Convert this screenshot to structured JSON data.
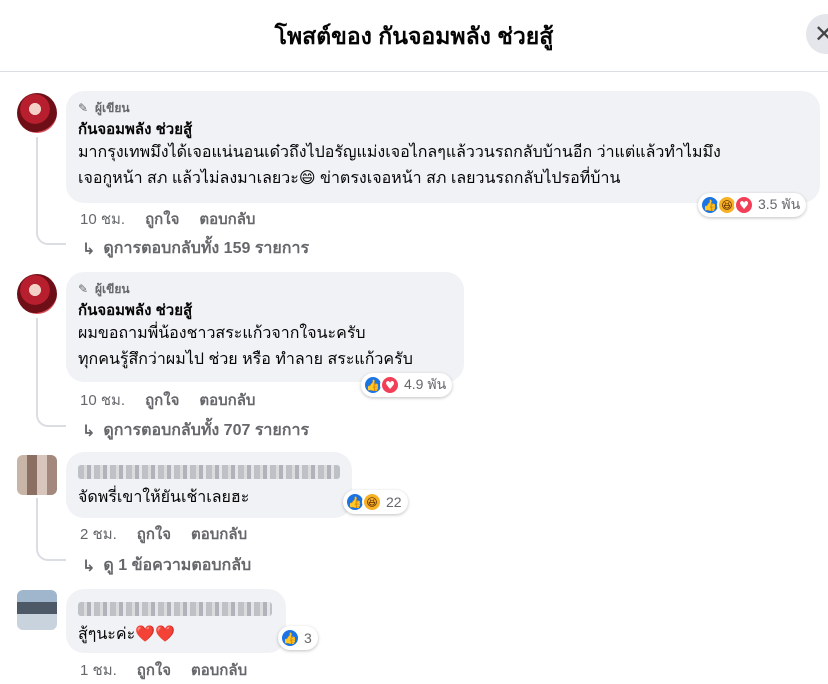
{
  "header": {
    "title": "โพสต์ของ กันจอมพลัง ช่วยสู้",
    "close_icon": "close-icon"
  },
  "comments": [
    {
      "badge": "ผู้เขียน",
      "name": "กันจอมพลัง ช่วยสู้",
      "lines": [
        "มากรุงเทพมึงได้เจอแน่นอนเด๋วถึงไปอรัญแม่งเจอไกลๆแล้ววนรถกลับบ้านอีก ว่าแต่แล้วทำไมมึง",
        "เจอกูหน้า สภ แล้วไม่ลงมาเลยวะ😄 ข่าตรงเจอหน้า สภ เลยวนรถกลับไปรอที่บ้าน"
      ],
      "reaction_count": "3.5 พัน",
      "time": "10 ชม.",
      "like_label": "ถูกใจ",
      "reply_label": "ตอบกลับ",
      "view_replies": "ดูการตอบกลับทั้ง 159 รายการ"
    },
    {
      "badge": "ผู้เขียน",
      "name": "กันจอมพลัง ช่วยสู้",
      "lines": [
        "ผมขอถามพี่น้องชาวสระแก้วจากใจนะครับ",
        "ทุกคนรู้สึกว่าผมไป ช่วย หรือ ทำลาย สระแก้วครับ"
      ],
      "reaction_count": "4.9 พัน",
      "time": "10 ชม.",
      "like_label": "ถูกใจ",
      "reply_label": "ตอบกลับ",
      "view_replies": "ดูการตอบกลับทั้ง 707 รายการ"
    },
    {
      "lines": [
        "จัดพรี่เขาให้ยันเช้าเลยฮะ"
      ],
      "reaction_count": "22",
      "time": "2 ชม.",
      "like_label": "ถูกใจ",
      "reply_label": "ตอบกลับ",
      "view_replies": "ดู 1 ข้อความตอบกลับ"
    },
    {
      "lines": [
        "สู้ๆนะค่ะ❤️❤️"
      ],
      "reaction_count": "3",
      "time": "1 ชม.",
      "like_label": "ถูกใจ",
      "reply_label": "ตอบกลับ"
    }
  ],
  "colors": {
    "like": "#1b74e4",
    "love": "#f33e58",
    "haha": "#f7b125",
    "bubble": "#f0f2f5",
    "meta": "#65676b"
  }
}
